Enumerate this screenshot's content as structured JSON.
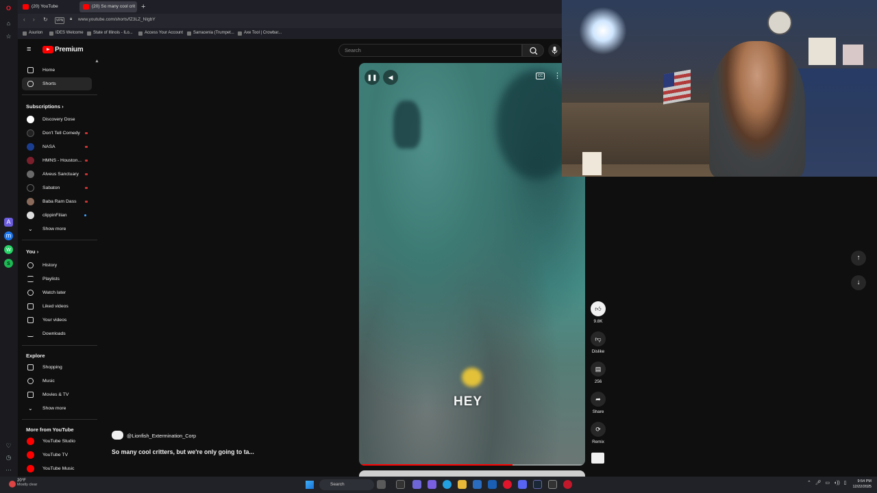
{
  "browser": {
    "tabs": [
      {
        "label": "(20) YouTube"
      },
      {
        "label": "(20) So many cool crit"
      }
    ],
    "new_tab": "+",
    "vpn": "VPN",
    "url": "www.youtube.com/shorts/fZ3LZ_NIgbY",
    "bookmarks": [
      "Asurion",
      "IDES Welcome",
      "State of Illinois - ILo...",
      "Access Your Account",
      "Sarracenia (Trumpet...",
      "Axe Tool | Crowbar..."
    ]
  },
  "youtube": {
    "logo_text": "Premium",
    "search_placeholder": "Search",
    "sidebar": {
      "main": [
        {
          "label": "Home",
          "icon": "home-icon"
        },
        {
          "label": "Shorts",
          "icon": "shorts-icon"
        }
      ],
      "subscriptions_title": "Subscriptions",
      "subscriptions": [
        {
          "label": "Discovery Dose",
          "badge": "",
          "color": "#ffffff"
        },
        {
          "label": "Don't Tell Comedy",
          "badge": "live",
          "color": "#222222"
        },
        {
          "label": "NASA",
          "badge": "live",
          "color": "#1a3d8f"
        },
        {
          "label": "HMNS - Houston...",
          "badge": "live",
          "color": "#7a1f2b"
        },
        {
          "label": "Alveus Sanctuary",
          "badge": "live",
          "color": "#6a6a6a"
        },
        {
          "label": "Sabaton",
          "badge": "live",
          "color": "#111111"
        },
        {
          "label": "Baba Ram Dass",
          "badge": "live",
          "color": "#8a6a5a"
        },
        {
          "label": "clippinFilian",
          "badge": "new",
          "color": "#dddddd"
        }
      ],
      "show_more_1": "Show more",
      "you_title": "You",
      "you": [
        {
          "label": "History"
        },
        {
          "label": "Playlists"
        },
        {
          "label": "Watch later"
        },
        {
          "label": "Liked videos"
        },
        {
          "label": "Your videos"
        },
        {
          "label": "Downloads"
        }
      ],
      "explore_title": "Explore",
      "explore": [
        {
          "label": "Shopping"
        },
        {
          "label": "Music"
        },
        {
          "label": "Movies & TV"
        }
      ],
      "show_more_2": "Show more",
      "more_title": "More from YouTube",
      "more": [
        {
          "label": "YouTube Studio"
        },
        {
          "label": "YouTube TV"
        },
        {
          "label": "YouTube Music"
        }
      ]
    },
    "short": {
      "caption": "HEY",
      "progress": 0.68,
      "channel": "@Lionfish_Extermination_Corp",
      "title": "So many cool critters, but we're only going to ta...",
      "cc": "CC",
      "actions": {
        "likes": "9.8K",
        "dislike": "Dislike",
        "comments": "256",
        "share": "Share",
        "remix": "Remix"
      }
    }
  },
  "taskbar": {
    "temp": "20°F",
    "weather": "Mostly clear",
    "search": "Search",
    "time": "9:54 PM",
    "date": "12/22/2025"
  },
  "colors": {
    "yt_red": "#ff0000",
    "bg": "#0f0f0f",
    "progress": "#ff0000"
  }
}
